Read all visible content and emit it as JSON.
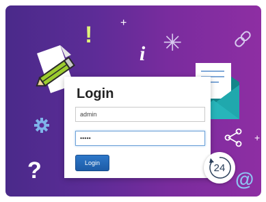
{
  "login": {
    "title": "Login",
    "username_value": "admin",
    "password_value": "•••••",
    "button_label": "Login"
  },
  "badge": {
    "number": "24"
  },
  "glyphs": {
    "exclamation": "!",
    "info": "i",
    "question": "?",
    "at": "@"
  },
  "colors": {
    "background_start": "#4a2a8a",
    "background_end": "#8e2ea3",
    "envelope": "#1fa3a8",
    "pencil": "#9ccc2e",
    "button": "#2d78c9",
    "icon_light": "#ffffff"
  },
  "icons": [
    "pencil-document-icon",
    "envelope-icon",
    "gear-icon",
    "link-icon",
    "share-icon",
    "sparkle-icon",
    "refresh-badge-icon"
  ]
}
